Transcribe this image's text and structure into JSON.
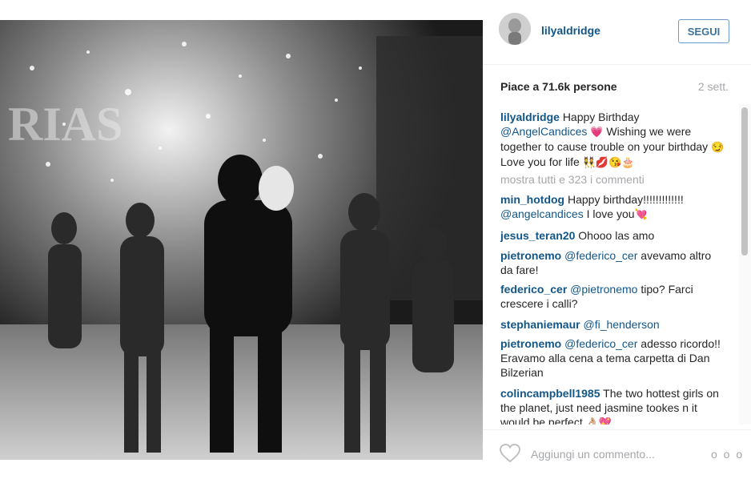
{
  "post": {
    "username": "lilyaldridge",
    "follow_label": "SEGUI",
    "likes_label": "Piace a 71.6k persone",
    "time_ago": "2 sett.",
    "caption": {
      "user": "lilyaldridge",
      "text1": "Happy Birthday",
      "mention": "@AngelCandices",
      "emoji1": "💗",
      "text2": "Wishing we were together to cause trouble on your birthday",
      "emoji2": "😏",
      "text3": "Love you for life",
      "emoji3": "👯💋😘🎂"
    },
    "show_all_comments": "mostra tutti e 323 i commenti",
    "comments": [
      {
        "user": "min_hotdog",
        "text": "Happy birthday!!!!!!!!!!!!!",
        "mention": "@angelcandices",
        "text2": "I love you",
        "emoji": "💘"
      },
      {
        "user": "jesus_teran20",
        "text": "Ohooo las amo"
      },
      {
        "user": "pietronemo",
        "mention": "@federico_cer",
        "text": "avevamo altro da fare!"
      },
      {
        "user": "federico_cer",
        "mention": "@pietronemo",
        "text": "tipo? Farci crescere i calli?"
      },
      {
        "user": "stephaniemaur",
        "mention": "@fi_henderson",
        "text": ""
      },
      {
        "user": "pietronemo",
        "mention": "@federico_cer",
        "text": "adesso ricordo!! Eravamo alla cena a tema carpetta di Dan Bilzerian"
      },
      {
        "user": "colincampbell1985",
        "text": "The two hottest girls on the planet, just need jasmine tookes n it would be perfect",
        "emoji": "👌🏼💖"
      }
    ],
    "add_comment_placeholder": "Aggiungi un commento...",
    "more_dots": "o o o"
  }
}
